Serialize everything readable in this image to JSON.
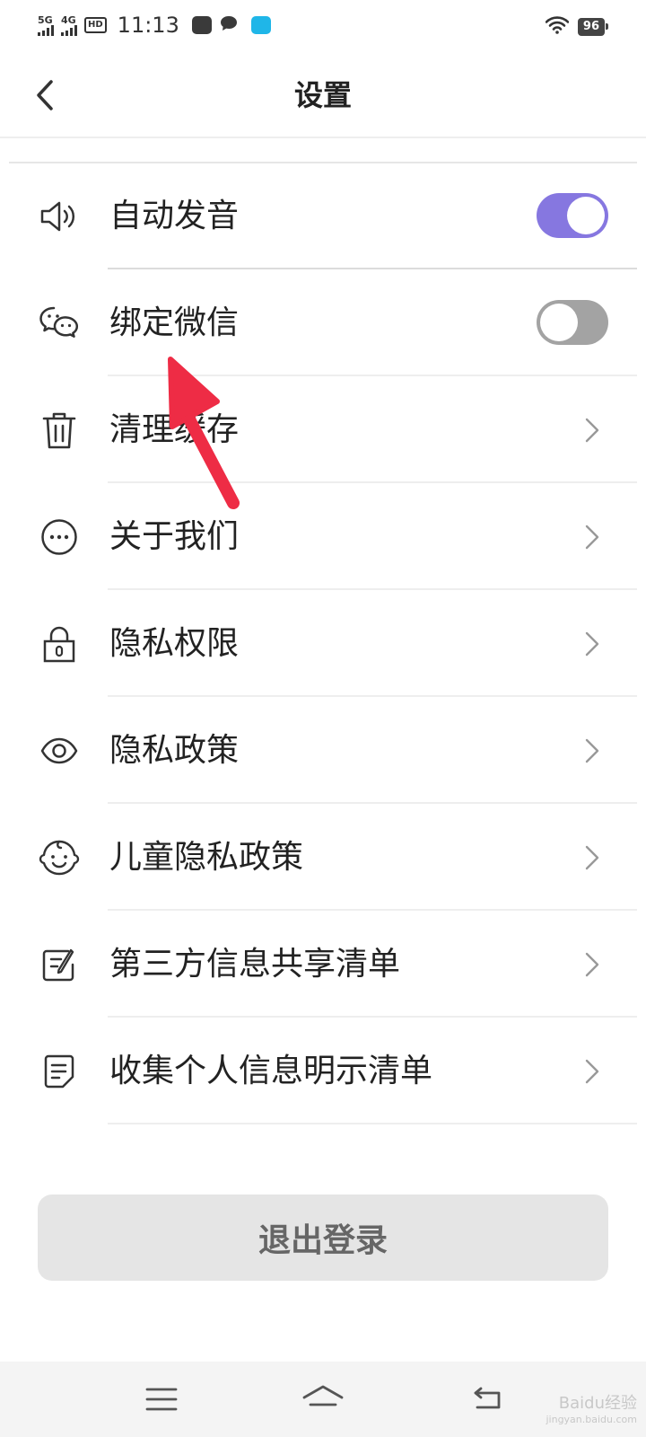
{
  "status_bar": {
    "network_1": "5G",
    "network_2": "4G",
    "hd": "HD",
    "time": "11:13",
    "battery": "96"
  },
  "header": {
    "title": "设置"
  },
  "settings": {
    "items": [
      {
        "label": "自动发音",
        "icon": "speaker-icon",
        "control": "toggle",
        "toggled": true
      },
      {
        "label": "绑定微信",
        "icon": "wechat-icon",
        "control": "toggle",
        "toggled": false
      },
      {
        "label": "清理缓存",
        "icon": "trash-icon",
        "control": "chevron"
      },
      {
        "label": "关于我们",
        "icon": "more-circle-icon",
        "control": "chevron"
      },
      {
        "label": "隐私权限",
        "icon": "lock-icon",
        "control": "chevron"
      },
      {
        "label": "隐私政策",
        "icon": "eye-icon",
        "control": "chevron"
      },
      {
        "label": "儿童隐私政策",
        "icon": "baby-face-icon",
        "control": "chevron"
      },
      {
        "label": "第三方信息共享清单",
        "icon": "edit-list-icon",
        "control": "chevron"
      },
      {
        "label": "收集个人信息明示清单",
        "icon": "document-icon",
        "control": "chevron"
      }
    ]
  },
  "logout": {
    "label": "退出登录"
  },
  "watermark": {
    "brand": "Baidu经验",
    "url": "jingyan.baidu.com"
  },
  "colors": {
    "accent": "#8677e0",
    "toggle_off": "#a3a3a3",
    "annotation_arrow": "#ee2c45",
    "logout_bg": "#e5e5e5"
  }
}
